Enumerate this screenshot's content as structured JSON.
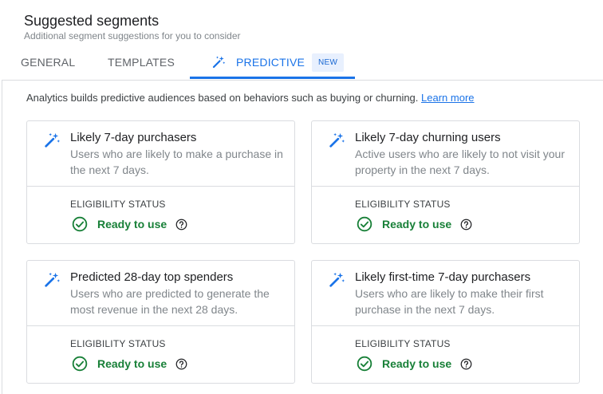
{
  "header": {
    "title": "Suggested segments",
    "subtitle": "Additional segment suggestions for you to consider"
  },
  "tabs": [
    {
      "label": "GENERAL",
      "active": false
    },
    {
      "label": "TEMPLATES",
      "active": false
    },
    {
      "label": "PREDICTIVE",
      "active": true,
      "badge": "NEW",
      "icon": "magic-wand-icon"
    }
  ],
  "info": {
    "text": "Analytics builds predictive audiences based on behaviors such as buying or churning.",
    "link": "Learn more"
  },
  "cards": [
    {
      "title": "Likely 7-day purchasers",
      "description": "Users who are likely to make a purchase in the next 7 days.",
      "eligibility_label": "ELIGIBILITY STATUS",
      "status": "Ready to use"
    },
    {
      "title": "Likely 7-day churning users",
      "description": "Active users who are likely to not visit your property in the next 7 days.",
      "eligibility_label": "ELIGIBILITY STATUS",
      "status": "Ready to use"
    },
    {
      "title": "Predicted 28-day top spenders",
      "description": "Users who are predicted to generate the most revenue in the next 28 days.",
      "eligibility_label": "ELIGIBILITY STATUS",
      "status": "Ready to use"
    },
    {
      "title": "Likely first-time 7-day purchasers",
      "description": "Users who are likely to make their first purchase in the next 7 days.",
      "eligibility_label": "ELIGIBILITY STATUS",
      "status": "Ready to use"
    }
  ],
  "colors": {
    "accent": "#1a73e8",
    "status_ok": "#188038",
    "badge_bg": "#e8f0fe"
  }
}
